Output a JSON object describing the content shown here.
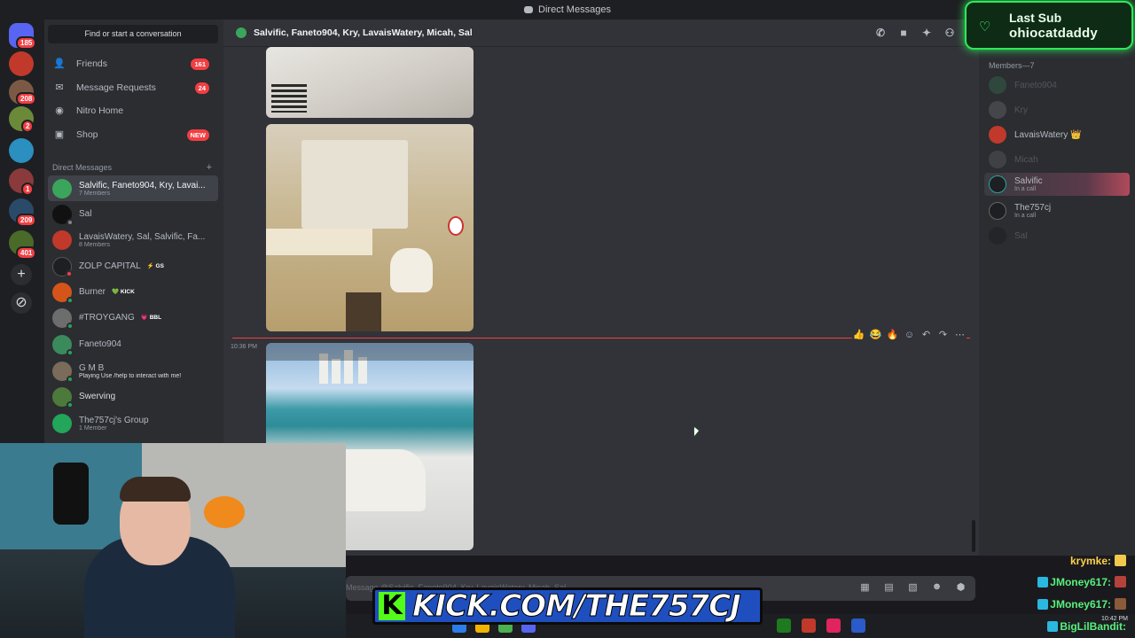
{
  "window": {
    "title": "Direct Messages"
  },
  "rail": {
    "badges": [
      "185",
      "208",
      "2",
      "1",
      "209",
      "401"
    ]
  },
  "sidebar": {
    "search": "Find or start a conversation",
    "nav": [
      {
        "label": "Friends",
        "count": "161",
        "icon": "friends-icon"
      },
      {
        "label": "Message Requests",
        "count": "24",
        "icon": "mail-icon"
      },
      {
        "label": "Nitro Home",
        "count": "",
        "icon": "nitro-icon"
      },
      {
        "label": "Shop",
        "count": "NEW",
        "icon": "shop-icon"
      }
    ],
    "dm_header": "Direct Messages",
    "dms": [
      {
        "name": "Salvific, Faneto904, Kry, Lavai...",
        "sub": "7 Members",
        "tag": "",
        "color": "#3ba55c"
      },
      {
        "name": "Sal",
        "sub": "",
        "tag": "",
        "color": "#111111"
      },
      {
        "name": "LavaisWatery, Sal, Salvific, Fa...",
        "sub": "8 Members",
        "tag": "",
        "color": "#c0392b"
      },
      {
        "name": "ZOLP CAPITAL",
        "sub": "",
        "tag": "⚡ GS",
        "color": "#1e1f22"
      },
      {
        "name": "Burner",
        "sub": "",
        "tag": "💚 KICK",
        "color": "#d4541a"
      },
      {
        "name": "#TROYGANG",
        "sub": "",
        "tag": "💗 BBL",
        "color": "#6d6d6d"
      },
      {
        "name": "Faneto904",
        "sub": "",
        "tag": "",
        "color": "#3b8a5c"
      },
      {
        "name": "G M B",
        "sub": "Playing Use /help to interact with me!",
        "tag": "",
        "color": "#7a6b5a"
      },
      {
        "name": "Swerving",
        "sub": "",
        "tag": "",
        "color": "#4c7a3a"
      },
      {
        "name": "The757cj's Group",
        "sub": "1 Member",
        "tag": "",
        "color": "#23a55a"
      }
    ]
  },
  "chat": {
    "title": "Salvific, Faneto904, Kry, LavaisWatery, Micah, Sal",
    "timestamp": "10:36 PM",
    "header_icons": [
      "phone-icon",
      "video-icon",
      "pin-icon",
      "add-member-icon",
      "members-icon"
    ],
    "reactions": [
      "👍",
      "😂",
      "🔥",
      "☺",
      "↶",
      "↷",
      "⋯"
    ],
    "composer_placeholder": "Message @Salvific, Faneto904, Kry, LavaisWatery, Micah, Sal",
    "composer_icons": [
      "gift-icon",
      "gif-icon",
      "sticker-icon",
      "emoji-icon",
      "game-icon"
    ]
  },
  "members": {
    "heading": "Members—7",
    "list": [
      {
        "name": "Faneto904",
        "status": "",
        "offline": true,
        "color": "#3b8a5c"
      },
      {
        "name": "Kry",
        "status": "",
        "offline": true,
        "color": "#888888"
      },
      {
        "name": "LavaisWatery 👑",
        "status": "",
        "offline": false,
        "color": "#c0392b"
      },
      {
        "name": "Micah",
        "status": "",
        "offline": true,
        "color": "#777777"
      },
      {
        "name": "Salvific",
        "status": "In a call",
        "offline": false,
        "color": "#1e1f22"
      },
      {
        "name": "The757cj",
        "status": "In a call",
        "offline": false,
        "color": "#1e1f22"
      },
      {
        "name": "Sal",
        "status": "",
        "offline": true,
        "color": "#111111"
      }
    ]
  },
  "overlay": {
    "last_sub_title": "Last Sub",
    "last_sub_name": "ohiocatdaddy",
    "kick_url": "KICK.COM/THE757CJ",
    "kick_letter": "K",
    "chat_lines": [
      {
        "name": "krymke:",
        "style": "y"
      },
      {
        "name": "JMoney617:",
        "style": "g"
      },
      {
        "name": "JMoney617:",
        "style": "g"
      },
      {
        "name": "BigLilBandit:",
        "style": "g"
      }
    ],
    "clock": "10:42 PM"
  }
}
